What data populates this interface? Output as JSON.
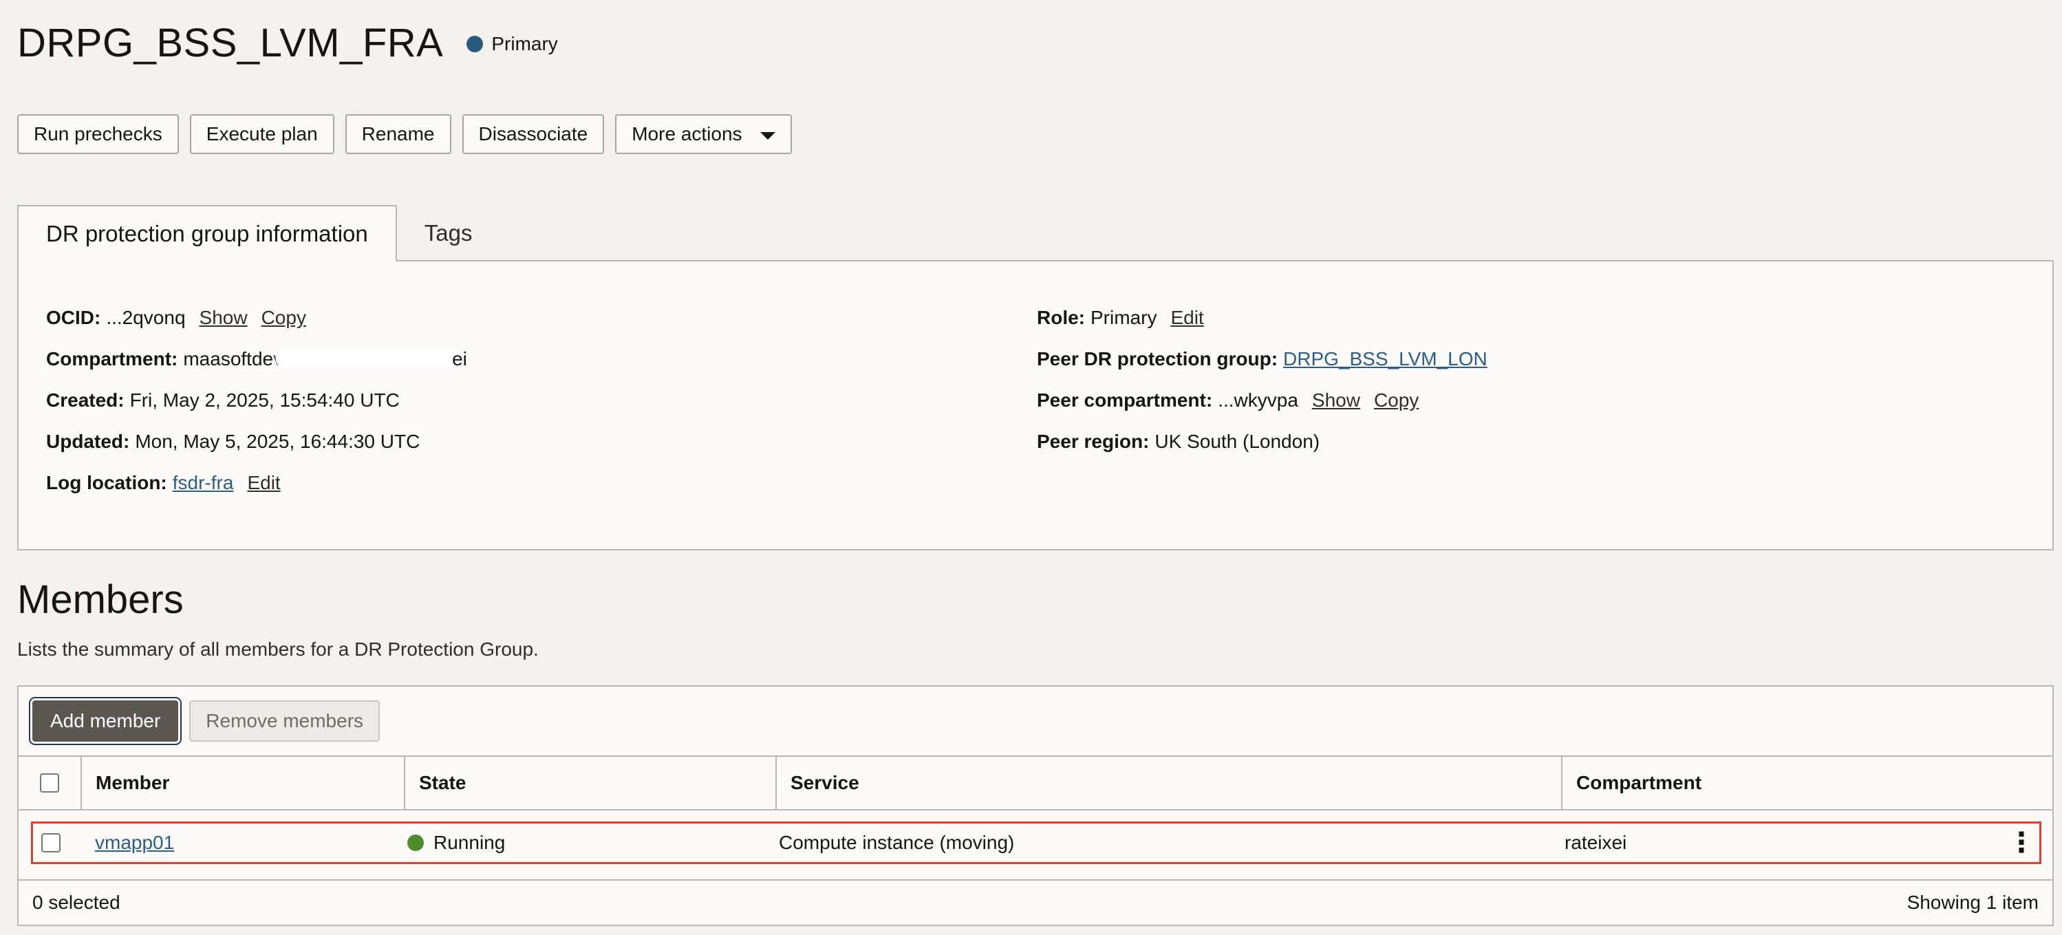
{
  "header": {
    "title": "DRPG_BSS_LVM_FRA",
    "status": "Primary",
    "status_color": "#2a5a7c"
  },
  "actions": {
    "run_prechecks": "Run prechecks",
    "execute_plan": "Execute plan",
    "rename": "Rename",
    "disassociate": "Disassociate",
    "more_actions": "More actions"
  },
  "tabs": [
    {
      "label": "DR protection group information",
      "active": true
    },
    {
      "label": "Tags",
      "active": false
    }
  ],
  "info": {
    "ocid": {
      "label": "OCID:",
      "value": "...2qvonq",
      "show": "Show",
      "copy": "Copy"
    },
    "compartment": {
      "label": "Compartment:",
      "value_start": "maasoftdev",
      "value_end": "ei"
    },
    "created": {
      "label": "Created:",
      "value": "Fri, May 2, 2025, 15:54:40 UTC"
    },
    "updated": {
      "label": "Updated:",
      "value": "Mon, May 5, 2025, 16:44:30 UTC"
    },
    "log_location": {
      "label": "Log location:",
      "value": "fsdr-fra",
      "edit": "Edit"
    },
    "role": {
      "label": "Role:",
      "value": "Primary",
      "edit": "Edit"
    },
    "peer_group": {
      "label": "Peer DR protection group:",
      "value": "DRPG_BSS_LVM_LON"
    },
    "peer_compartment": {
      "label": "Peer compartment:",
      "value": "...wkyvpa",
      "show": "Show",
      "copy": "Copy"
    },
    "peer_region": {
      "label": "Peer region:",
      "value": "UK South (London)"
    }
  },
  "members": {
    "title": "Members",
    "description": "Lists the summary of all members for a DR Protection Group.",
    "add_button": "Add member",
    "remove_button": "Remove members",
    "columns": [
      "Member",
      "State",
      "Service",
      "Compartment"
    ],
    "rows": [
      {
        "member": "vmapp01",
        "state": "Running",
        "state_color": "#4f8a2b",
        "service": "Compute instance (moving)",
        "compartment": "rateixei"
      }
    ],
    "selected_text": "0 selected",
    "showing_text": "Showing 1 item"
  }
}
